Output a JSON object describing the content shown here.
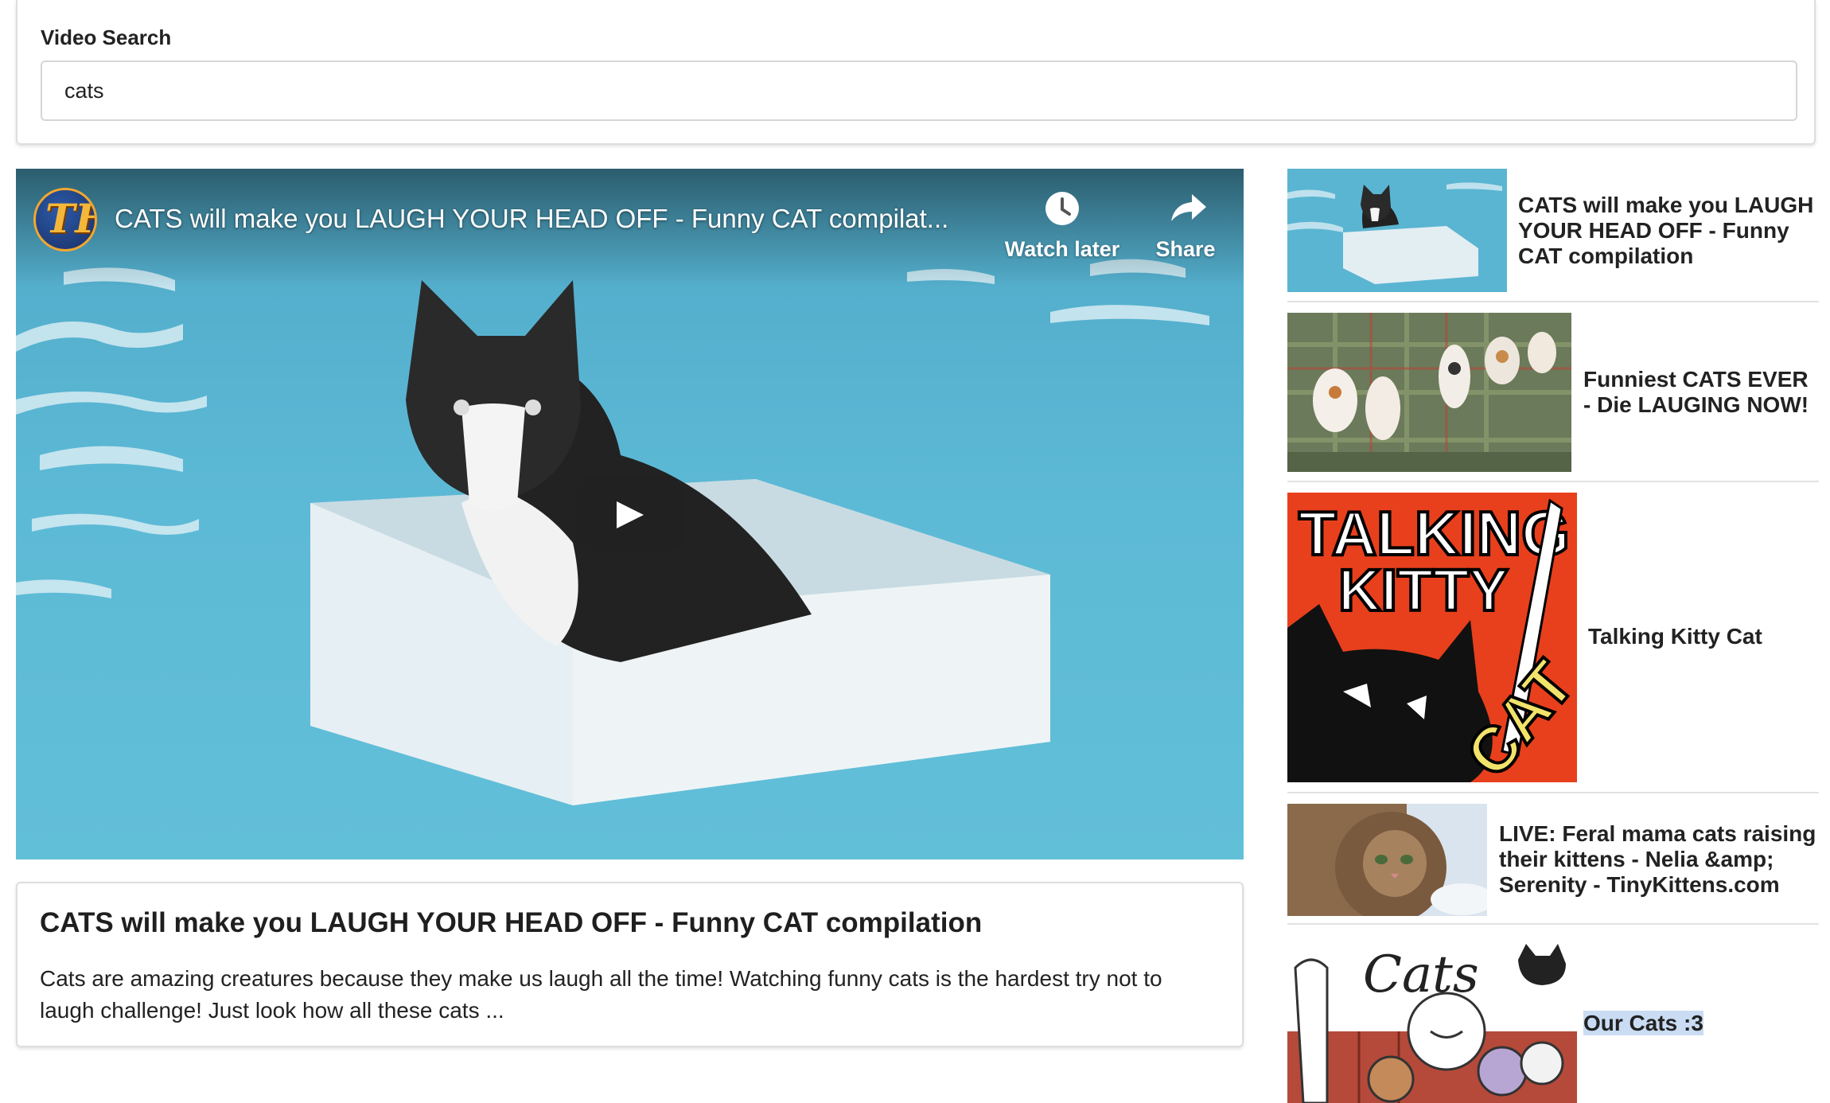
{
  "search": {
    "label": "Video Search",
    "value": "cats"
  },
  "player": {
    "title": "CATS will make you LAUGH YOUR HEAD OFF - Funny CAT compilat...",
    "watch_later_label": "Watch later",
    "share_label": "Share",
    "channel_logo": "TF"
  },
  "selected_video": {
    "title": "CATS will make you LAUGH YOUR HEAD OFF - Funny CAT compilation",
    "description": "Cats are amazing creatures because they make us laugh all the time! Watching funny cats is the hardest try not to laugh challenge! Just look how all these cats ..."
  },
  "video_list": [
    {
      "title": "CATS will make you LAUGH YOUR HEAD OFF - Funny CAT compilation",
      "thumb": "cat-in-box-pool"
    },
    {
      "title": "Funniest CATS EVER - Die LAUGING NOW!",
      "thumb": "kittens-on-couch"
    },
    {
      "title": "Talking Kitty Cat",
      "thumb": "talking-kitty-cat-logo",
      "thumb_text": [
        "TALKING",
        "KITTY",
        "CAT"
      ]
    },
    {
      "title": "LIVE: Feral mama cats raising their kittens - Nelia &amp; Serenity - TinyKittens.com",
      "thumb": "fluffy-kitten"
    },
    {
      "title": "Our Cats :3",
      "thumb": "cartoon-cats",
      "thumb_text": "Cats"
    }
  ],
  "colors": {
    "pool_water": "#5cb7d3",
    "talking_kitty_red": "#e8401c",
    "selection_highlight": "#c9dcf3"
  }
}
